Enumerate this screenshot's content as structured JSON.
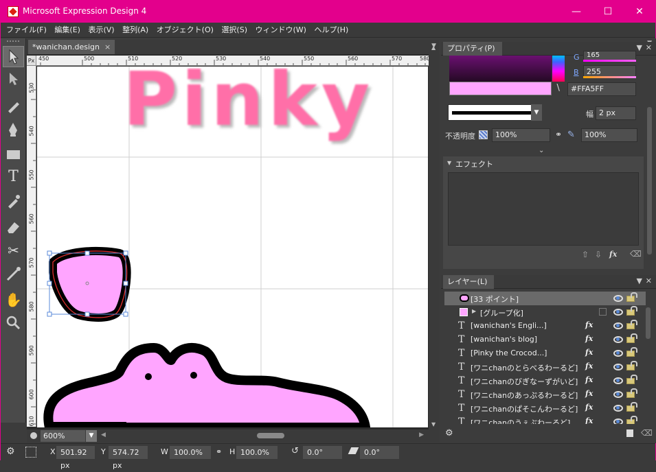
{
  "window": {
    "title": "Microsoft Expression Design 4",
    "accent": "#e3008c"
  },
  "menu": [
    "ファイル(F)",
    "編集(E)",
    "表示(V)",
    "整列(A)",
    "オブジェクト(O)",
    "選択(S)",
    "ウィンドウ(W)",
    "ヘルプ(H)"
  ],
  "document": {
    "tab": "*wanichan.design",
    "close": "×"
  },
  "ruler": {
    "unit": "Px",
    "top": [
      "450",
      "500",
      "510",
      "520",
      "530",
      "540",
      "550",
      "560",
      "570",
      "580"
    ],
    "left": [
      "530",
      "540",
      "550",
      "560",
      "570",
      "580",
      "590",
      "600",
      "610"
    ]
  },
  "canvas": {
    "text": "Pinky",
    "fill": "#ffa5ff"
  },
  "zoom": "600%",
  "properties": {
    "tab": "プロパティ(P)",
    "g_label": "G",
    "g_value": "165",
    "b_label": "B",
    "b_value": "255",
    "hex": "#FFA5FF",
    "width_label": "幅",
    "width_value": "2 px",
    "opacity_label": "不透明度",
    "opacity1": "100%",
    "opacity2": "100%"
  },
  "effects": {
    "title": "エフェクト"
  },
  "layers": {
    "tab": "レイヤー(L)",
    "rows": [
      {
        "name": "[33 ポイント]",
        "fx": ""
      },
      {
        "name": "[グループ化]",
        "fx": ""
      },
      {
        "name": "[wanichan's Engli...]",
        "fx": "fx"
      },
      {
        "name": "[wanichan's blog]",
        "fx": "fx"
      },
      {
        "name": "[Pinky the Crocod...]",
        "fx": "fx"
      },
      {
        "name": "[ワニchanのとらべるわーるど]",
        "fx": "fx"
      },
      {
        "name": "[ワニchanのびぎなーずがいど]",
        "fx": "fx"
      },
      {
        "name": "[ワニchanのあっぷるわーるど]",
        "fx": "fx"
      },
      {
        "name": "[ワニchanのぱそこんわーるど]",
        "fx": "fx"
      },
      {
        "name": "[ワニchanのうぇぶわーるど]",
        "fx": "fx"
      }
    ]
  },
  "status": {
    "x_label": "X",
    "x_value": "501.92 px",
    "y_label": "Y",
    "y_value": "574.72 px",
    "w_label": "W",
    "w_value": "100.0%",
    "h_label": "H",
    "h_value": "100.0%",
    "rot_value": "0.0°",
    "skew_value": "0.0°"
  }
}
